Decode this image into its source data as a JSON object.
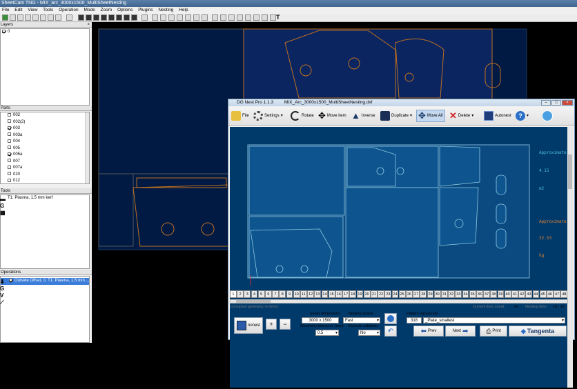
{
  "main_title": "SheetCam TNG - MIX_arc_3000x1500_MultiSheetNesting",
  "menu": [
    "File",
    "Edit",
    "View",
    "Tools",
    "Operation",
    "Mode",
    "Zoom",
    "Options",
    "Plugins",
    "Nesting",
    "Help"
  ],
  "layers": {
    "header": "Layers",
    "items": [
      {
        "label": "0",
        "checked": true
      }
    ]
  },
  "parts": {
    "header": "Parts",
    "items": [
      {
        "label": "002",
        "checked": false
      },
      {
        "label": "002(2)",
        "checked": false
      },
      {
        "label": "003",
        "checked": true
      },
      {
        "label": "003a",
        "checked": false
      },
      {
        "label": "004",
        "checked": false
      },
      {
        "label": "005",
        "checked": false
      },
      {
        "label": "005a",
        "checked": true
      },
      {
        "label": "007",
        "checked": false
      },
      {
        "label": "007a",
        "checked": false
      },
      {
        "label": "020",
        "checked": false
      },
      {
        "label": "012",
        "checked": false
      }
    ]
  },
  "tools": {
    "header": "Tools",
    "items": [
      {
        "label": "T1: Plasma, 1.5 mm kerf"
      }
    ]
  },
  "operations": {
    "header": "Operations",
    "items": [
      {
        "label": "Outside Offset, 0, T1: Plasma, 1.5 mm ...",
        "checked": true
      }
    ]
  },
  "dg": {
    "title": "DG Nest Pro 1.1.3",
    "filename": "MIX_Arc_3000x1500_MultiSheetNesting.dxf",
    "toolbar": {
      "file": "File",
      "settings": "Settings",
      "rotate": "Rotate",
      "move_item": "Move item",
      "inverse": "Inverse",
      "duplicate": "Duplicate",
      "move_all": "Move All",
      "delete": "Delete",
      "autonest": "Autonest"
    },
    "side_text": {
      "approx1": "Approximate",
      "val1": "4.15",
      "unit1": "m2",
      "approx2": "Approximate",
      "val2": "32.53",
      "unit2": "kg"
    },
    "pages": [
      "1",
      "2",
      "3",
      "4",
      "5",
      "6",
      "7",
      "8",
      "9",
      "10",
      "11",
      "12",
      "13",
      "14",
      "15",
      "16",
      "17",
      "18",
      "19",
      "20",
      "21",
      "22",
      "23",
      "24",
      "25",
      "26",
      "27",
      "28",
      "29",
      "30",
      "31",
      "32",
      "33",
      "34",
      "35",
      "36",
      "37",
      "38",
      "39",
      "40",
      "41",
      "42",
      "43",
      "44",
      "45",
      "46",
      "47",
      "48"
    ],
    "info": {
      "corrupted": "Corrupted geometry in items:",
      "count_label": "Current item count:",
      "count_value": "41",
      "time_label": "Nesting time:",
      "time_value": "10 : 12"
    },
    "bottom": {
      "save_label": "Save",
      "nest_label": "nonest",
      "sheet_dim_label": "Sheet dimensions",
      "sheet_dim_value": "3000 x 1500",
      "geo_tol_label": "Geometry tolerance (mm)",
      "geo_tol_value": "0.5",
      "nest_speed_label": "Nesting speed",
      "nest_speed_value": "Fast",
      "exclude_label": "Exclude subitems",
      "exclude_value": "No",
      "pattern_label": "Pattern layouts list",
      "pattern_count": "318",
      "pattern_value": "_Plate_smallest",
      "prev": "Prev",
      "next": "Next",
      "print": "Print",
      "brand": "Tangenta"
    }
  }
}
